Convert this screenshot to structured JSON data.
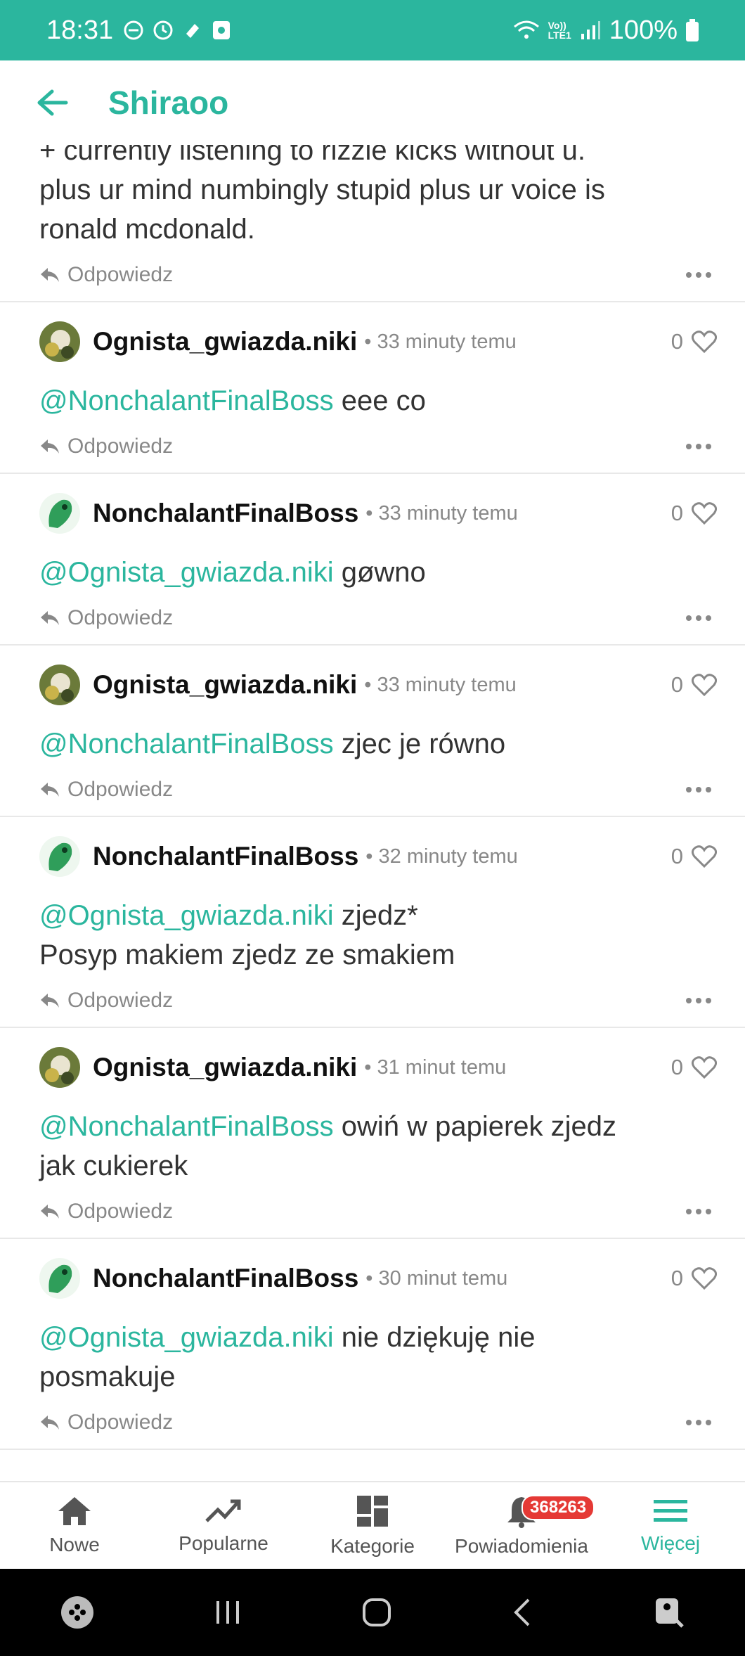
{
  "status_bar": {
    "time": "18:31",
    "network": "Vo))\nLTE1",
    "battery": "100%"
  },
  "header": {
    "title": "Shiraoo"
  },
  "first_comment": {
    "lines": [
      "+ currently listening to rizzle kicks without u.",
      "plus ur mind numbingly stupid plus ur voice is",
      "ronald mcdonald."
    ],
    "reply_label": "Odpowiedz"
  },
  "comments": [
    {
      "user": "Ognista_gwiazda.niki",
      "time": "33 minuty temu",
      "likes": "0",
      "mention": "@NonchalantFinalBoss",
      "text": "eee co",
      "reply_label": "Odpowiedz",
      "avatar": "bird-avatar"
    },
    {
      "user": "NonchalantFinalBoss",
      "time": "33 minuty temu",
      "likes": "0",
      "mention": "@Ognista_gwiazda.niki",
      "text": "gøwno",
      "reply_label": "Odpowiedz",
      "avatar": "dragon-avatar"
    },
    {
      "user": "Ognista_gwiazda.niki",
      "time": "33 minuty temu",
      "likes": "0",
      "mention": "@NonchalantFinalBoss",
      "text": "zjec je równo",
      "reply_label": "Odpowiedz",
      "avatar": "bird-avatar"
    },
    {
      "user": "NonchalantFinalBoss",
      "time": "32 minuty temu",
      "likes": "0",
      "mention": "@Ognista_gwiazda.niki",
      "text": "zjedz*",
      "text2": "Posyp makiem zjedz ze smakiem",
      "reply_label": "Odpowiedz",
      "avatar": "dragon-avatar"
    },
    {
      "user": "Ognista_gwiazda.niki",
      "time": "31 minut temu",
      "likes": "0",
      "mention": "@NonchalantFinalBoss",
      "text": "owiń w papierek zjedz",
      "text2": "jak cukierek",
      "reply_label": "Odpowiedz",
      "avatar": "bird-avatar"
    },
    {
      "user": "NonchalantFinalBoss",
      "time": "30 minut temu",
      "likes": "0",
      "mention": "@Ognista_gwiazda.niki",
      "text": "nie dziękuję nie",
      "text2": "posmakuje",
      "reply_label": "Odpowiedz",
      "avatar": "dragon-avatar"
    }
  ],
  "bottom_nav": {
    "items": [
      {
        "label": "Nowe",
        "icon": "home-icon"
      },
      {
        "label": "Popularne",
        "icon": "trending-icon"
      },
      {
        "label": "Kategorie",
        "icon": "dashboard-icon"
      },
      {
        "label": "Powiadomienia",
        "icon": "bell-icon",
        "badge": "368263"
      },
      {
        "label": "Więcej",
        "icon": "menu-icon"
      }
    ]
  },
  "colors": {
    "accent": "#2bb69e",
    "badge": "#e53935"
  }
}
